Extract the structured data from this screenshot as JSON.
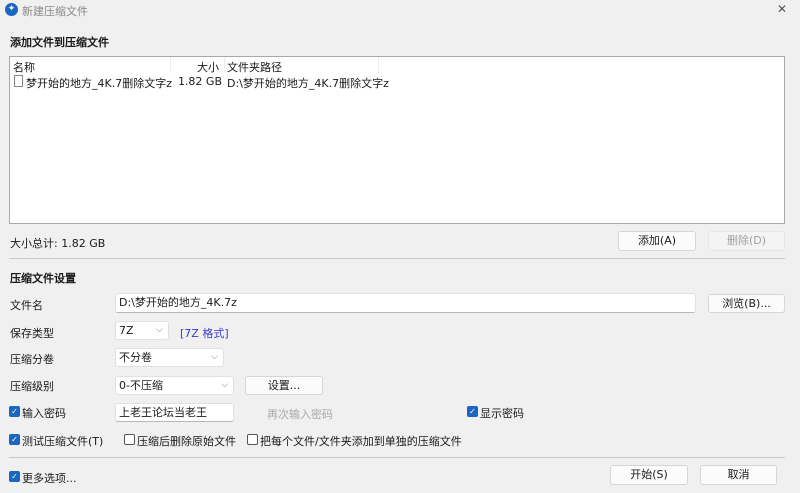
{
  "window": {
    "title": "新建压缩文件",
    "close": "✕"
  },
  "files": {
    "heading": "添加文件到压缩文件",
    "columns": [
      "名称",
      "大小",
      "文件夹路径"
    ],
    "rows": [
      {
        "name": "梦开始的地方_4K.7删除文字z",
        "size": "1.82 GB",
        "path": "D:\\梦开始的地方_4K.7删除文字z"
      }
    ],
    "total": "大小总计: 1.82 GB",
    "add": "添加(A)",
    "remove": "删除(D)"
  },
  "settings": {
    "heading": "压缩文件设置",
    "filename_label": "文件名",
    "filename": "D:\\梦开始的地方_4K.7z",
    "browse": "浏览(B)...",
    "type_label": "保存类型",
    "type": "7Z",
    "type_format": "[7Z 格式]",
    "split_label": "压缩分卷",
    "split": "不分卷",
    "level_label": "压缩级别",
    "level": "0-不压缩",
    "level_settings": "设置...",
    "password_label": "输入密码",
    "password_checked": true,
    "password": "上老王论坛当老王",
    "password_confirm_placeholder": "再次输入密码",
    "show_password": "显示密码",
    "show_password_checked": true,
    "test": "测试压缩文件(T)",
    "test_checked": true,
    "delete_after": "压缩后删除原始文件",
    "delete_after_checked": false,
    "separate": "把每个文件/文件夹添加到单独的压缩文件",
    "separate_checked": false
  },
  "footer": {
    "more": "更多选项...",
    "more_checked": true,
    "start": "开始(S)",
    "cancel": "取消"
  },
  "colors": {
    "accent": "#1a66c0",
    "link": "#3a3ad0"
  }
}
